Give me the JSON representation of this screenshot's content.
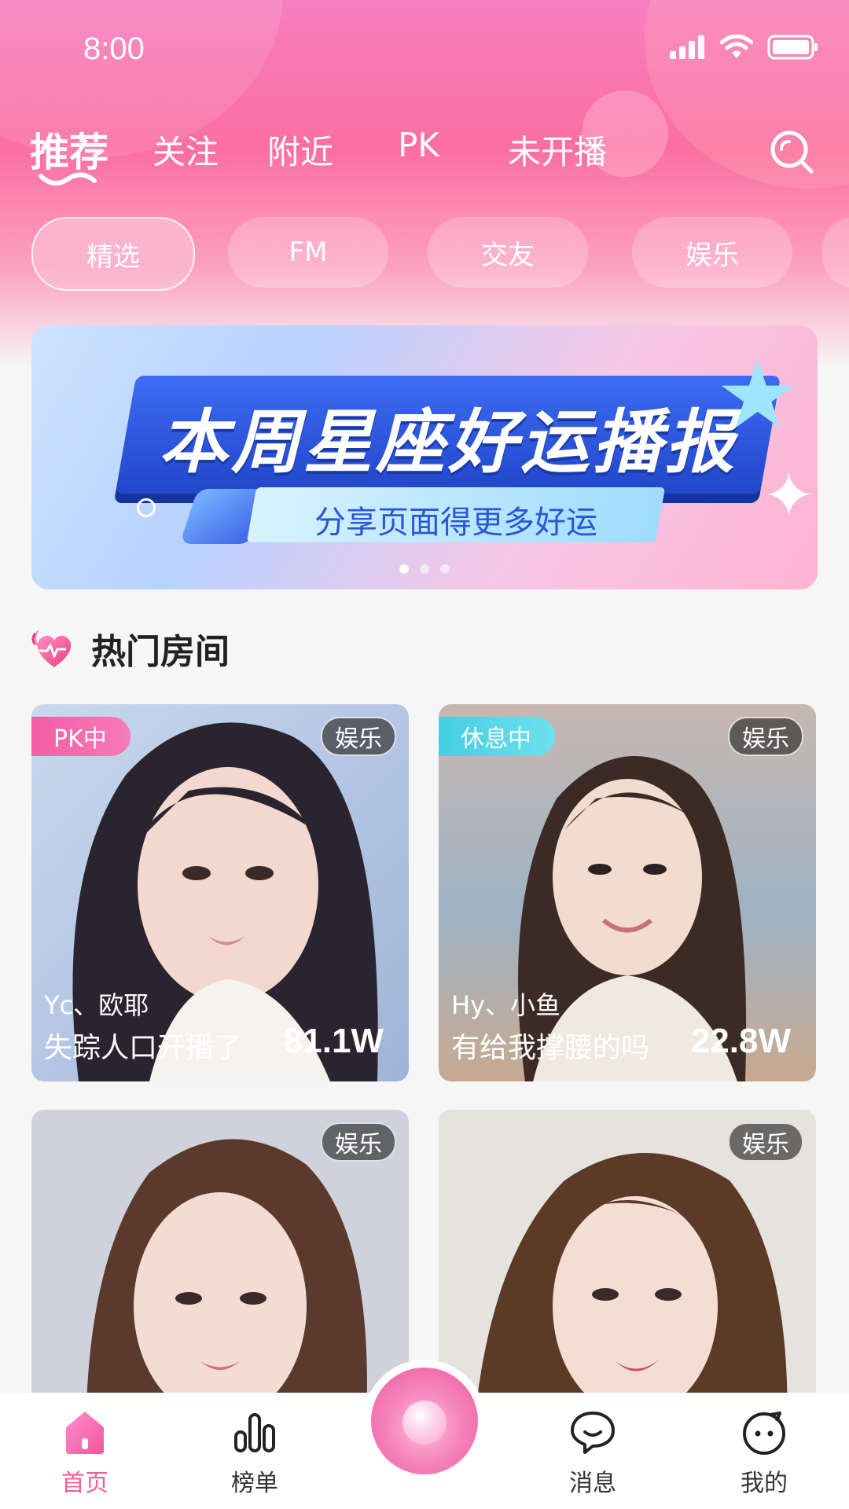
{
  "status": {
    "time": "8:00"
  },
  "tabs": [
    {
      "label": "推荐"
    },
    {
      "label": "关注"
    },
    {
      "label": "附近"
    },
    {
      "label": "PK"
    },
    {
      "label": "未开播"
    }
  ],
  "chips": [
    {
      "label": "精选"
    },
    {
      "label": "FM"
    },
    {
      "label": "交友"
    },
    {
      "label": "娱乐"
    }
  ],
  "banner": {
    "title": "本周星座好运播报",
    "subtitle": "分享页面得更多好运",
    "page_count": 3,
    "active_page": 1
  },
  "section": {
    "title": "热门房间"
  },
  "rooms": [
    {
      "status": "PK中",
      "status_color": "#f45ea6",
      "tag": "娱乐",
      "user": "Yc、欧耶",
      "title": "失踪人口开播了",
      "count": "81.1W"
    },
    {
      "status": "休息中",
      "status_color": "#44cfe0",
      "tag": "娱乐",
      "user": "Hy、小鱼",
      "title": "有给我撑腰的吗",
      "count": "22.8W"
    },
    {
      "status": "",
      "tag": "娱乐",
      "user": "",
      "title": "",
      "count": ""
    },
    {
      "status": "",
      "tag": "娱乐",
      "user": "",
      "title": "",
      "count": ""
    }
  ],
  "nav": [
    {
      "label": "首页",
      "icon": "home-icon"
    },
    {
      "label": "榜单",
      "icon": "ranking-icon"
    },
    {
      "label": "消息",
      "icon": "message-icon"
    },
    {
      "label": "我的",
      "icon": "profile-icon"
    }
  ],
  "colors": {
    "accent": "#f0609a",
    "header_top": "#f77fc0",
    "header_mid": "#fb6fa0"
  }
}
